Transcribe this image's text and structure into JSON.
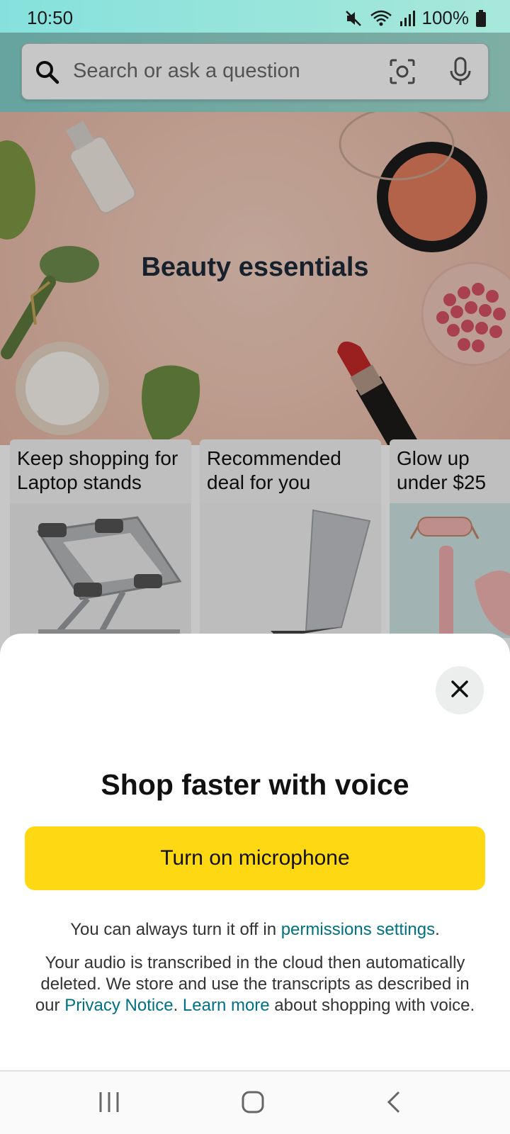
{
  "status_bar": {
    "time": "10:50",
    "battery": "100%",
    "icons": [
      "mute-icon",
      "wifi-icon",
      "signal-icon",
      "battery-icon"
    ]
  },
  "search": {
    "placeholder": "Search or ask a question",
    "icons": [
      "search-icon",
      "camera-icon",
      "microphone-icon"
    ]
  },
  "hero": {
    "title": "Beauty essentials"
  },
  "cards": [
    {
      "title": "Keep shopping for Laptop stands"
    },
    {
      "title": "Recommended deal for you"
    },
    {
      "title": "Glow up under $25"
    }
  ],
  "sheet": {
    "title": "Shop faster with voice",
    "button_label": "Turn on microphone",
    "line1_prefix": "You can always turn it off in ",
    "line1_link": "permissions settings",
    "line1_suffix": ".",
    "para_text1": "Your audio is transcribed in the cloud then automatically deleted. We store and use the transcripts as described in our ",
    "privacy_link": "Privacy Notice",
    "para_text2": ". ",
    "learn_more_link": "Learn more",
    "para_text3": " about shopping with voice."
  },
  "nav": {
    "icons": [
      "recent-apps-icon",
      "home-icon",
      "back-icon"
    ]
  },
  "colors": {
    "accent_button": "#ffd814",
    "link": "#007185",
    "header": "#86e1dc"
  }
}
